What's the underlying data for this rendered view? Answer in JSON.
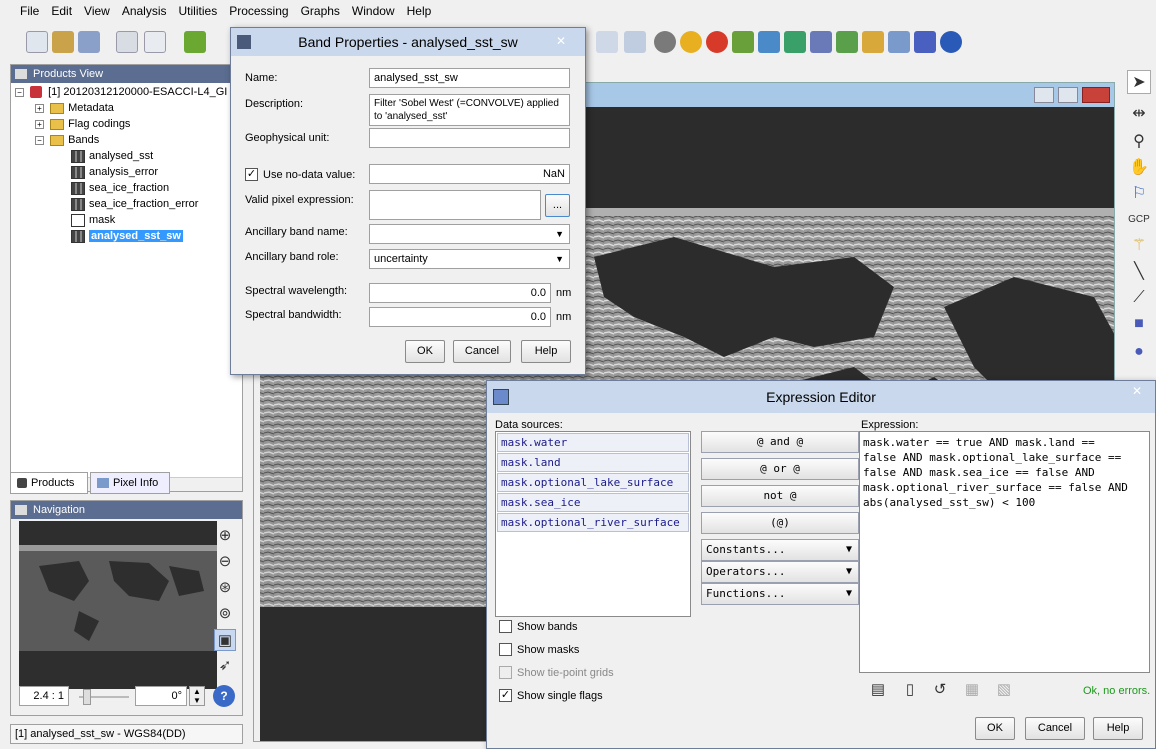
{
  "menu": [
    "File",
    "Edit",
    "View",
    "Analysis",
    "Utilities",
    "Processing",
    "Graphs",
    "Window",
    "Help"
  ],
  "products_view": {
    "title": "Products View",
    "product": "[1] 20120312120000-ESACCI-L4_GI",
    "nodes": [
      "Metadata",
      "Flag codings",
      "Bands"
    ],
    "bands": [
      "analysed_sst",
      "analysis_error",
      "sea_ice_fraction",
      "sea_ice_fraction_error",
      "mask",
      "analysed_sst_sw"
    ]
  },
  "tabs": [
    "Products",
    "Pixel Info"
  ],
  "navigation": {
    "title": "Navigation",
    "zoom": "2.4 : 1",
    "rotation": "0°"
  },
  "status": "[1] analysed_sst_sw - WGS84(DD)",
  "band_properties": {
    "title": "Band Properties - analysed_sst_sw",
    "name_label": "Name:",
    "name_value": "analysed_sst_sw",
    "description_label": "Description:",
    "description_value": "Filter 'Sobel West' (=CONVOLVE) applied to 'analysed_sst'",
    "unit_label": "Geophysical unit:",
    "unit_value": "",
    "nodata_label": "Use no-data value:",
    "nodata_value": "NaN",
    "valid_label": "Valid pixel expression:",
    "valid_btn": "...",
    "anc_name_label": "Ancillary band name:",
    "anc_role_label": "Ancillary band role:",
    "anc_role_value": "uncertainty",
    "wavelength_label": "Spectral wavelength:",
    "wavelength_value": "0.0",
    "bandwidth_label": "Spectral bandwidth:",
    "bandwidth_value": "0.0",
    "unit_nm": "nm",
    "ok": "OK",
    "cancel": "Cancel",
    "help": "Help"
  },
  "expression_editor": {
    "title": "Expression Editor",
    "sources_label": "Data sources:",
    "sources": [
      "mask.water",
      "mask.land",
      "mask.optional_lake_surface",
      "mask.sea_ice",
      "mask.optional_river_surface"
    ],
    "operators": [
      "@ and @",
      "@ or @",
      "not @",
      "(@)"
    ],
    "dropdowns": [
      "Constants...",
      "Operators...",
      "Functions..."
    ],
    "expression_label": "Expression:",
    "expression": "mask.water == true AND mask.land ==\nfalse AND mask.optional_lake_surface ==\nfalse AND mask.sea_ice == false AND\nmask.optional_river_surface == false AND\nabs(analysed_sst_sw) < 100",
    "checks": [
      {
        "label": "Show bands",
        "checked": false
      },
      {
        "label": "Show masks",
        "checked": false
      },
      {
        "label": "Show tie-point grids",
        "checked": false
      },
      {
        "label": "Show single flags",
        "checked": true
      }
    ],
    "status": "Ok, no errors.",
    "ok": "OK",
    "cancel": "Cancel",
    "help": "Help"
  },
  "colors": {
    "title_bar": "#5b6d90",
    "selection": "#3399ff",
    "status_ok": "#1a9a1a",
    "source_text": "#1a1a8a"
  }
}
